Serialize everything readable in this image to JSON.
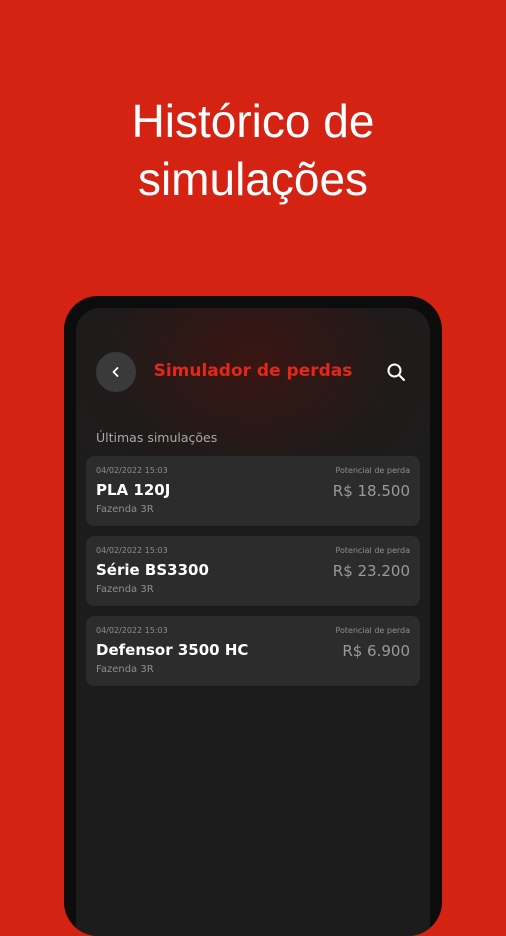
{
  "headline": {
    "line1": "Histórico de",
    "line2": "simulações"
  },
  "appbar": {
    "title": "Simulador de perdas",
    "back_icon": "chevron-left-icon",
    "search_icon": "search-icon"
  },
  "section": {
    "label": "Últimas simulações"
  },
  "simulations": [
    {
      "date": "04/02/2022 15:03",
      "loss_label": "Potencial de perda",
      "name": "PLA 120J",
      "value": "R$ 18.500",
      "farm": "Fazenda 3R"
    },
    {
      "date": "04/02/2022 15:03",
      "loss_label": "Potencial de perda",
      "name": "Série BS3300",
      "value": "R$ 23.200",
      "farm": "Fazenda 3R"
    },
    {
      "date": "04/02/2022 15:03",
      "loss_label": "Potencial de perda",
      "name": "Defensor 3500 HC",
      "value": "R$ 6.900",
      "farm": "Fazenda 3R"
    }
  ],
  "colors": {
    "background": "#d42213",
    "accent": "#e32719",
    "card": "#2c2c2c"
  }
}
